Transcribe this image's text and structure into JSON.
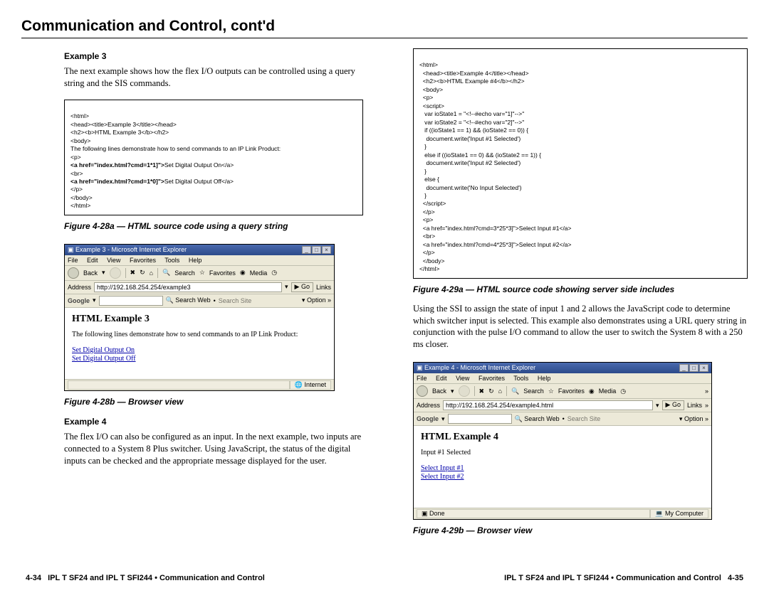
{
  "title": "Communication and Control, cont'd",
  "left": {
    "ex3_heading": "Example 3",
    "ex3_text": "The next example shows how the flex I/O outputs can be controlled using a query string and the SIS commands.",
    "code1": {
      "l1": "<html>",
      "l2": "<head><title>Example 3</title></head>",
      "l3": "<h2><b>HTML Example 3</b></h2>",
      "l4": "<body>",
      "l5": "The following lines demonstrate how to send commands to an IP Link Product:",
      "l6": "<p>",
      "l7a": "<a href=\"index.html?cmd=1*1]\">",
      "l7b": "Set Digital Output On</a>",
      "l8": "<br>",
      "l9a": "<a href=\"index.html?cmd=1*0]\">",
      "l9b": "Set Digital Output Off</a>",
      "l10": "</p>",
      "l11": "</body>",
      "l12": "</html>"
    },
    "caption_28a": "Figure 4-28a — HTML source code using a query string",
    "browser1": {
      "title": "Example 3 - Microsoft Internet Explorer",
      "menu": {
        "file": "File",
        "edit": "Edit",
        "view": "View",
        "fav": "Favorites",
        "tools": "Tools",
        "help": "Help"
      },
      "back": "Back",
      "search": "Search",
      "favorites": "Favorites",
      "media": "Media",
      "addr_label": "Address",
      "addr": "http://192.168.254.254/example3",
      "go": "Go",
      "links": "Links",
      "google": "Google",
      "sw": "Search Web",
      "ss": "Search Site",
      "opt": "Option",
      "heading": "HTML Example 3",
      "line": "The following lines demonstrate how to send commands to an IP Link Product:",
      "link1": "Set Digital Output On",
      "link2": "Set Digital Output Off",
      "status": "Internet"
    },
    "caption_28b": "Figure 4-28b — Browser view",
    "ex4_heading": "Example 4",
    "ex4_text": "The flex I/O can also be configured as an input.  In the next example, two inputs are connected to a System 8 Plus switcher.  Using JavaScript, the status of the digital inputs can be checked and the appropriate message displayed for the user."
  },
  "right": {
    "code2": {
      "l1": "<html>",
      "l2": "<head><title>Example 4</title></head>",
      "l3": "<h2><b>HTML Example #4</b></h2>",
      "l4": "<body>",
      "l5": "<p>",
      "l6": "<script>",
      "l7": " var ioState1 = \"<!--#echo var=\"1]\"-->\"",
      "l8": " var ioState2 = \"<!--#echo var=\"2]\"-->\"",
      "l9": " if ((ioState1 == 1) && (ioState2 == 0)) {",
      "l10": "  document.write('Input #1 Selected')",
      "l11": " }",
      "l12": " else if ((ioState1 == 0) && (ioState2 == 1)) {",
      "l13": "  document.write('Input #2 Selected')",
      "l14": " }",
      "l15": " else {",
      "l16": "  document.write('No Input Selected')",
      "l17": " }",
      "l18": "</script>",
      "l19": "</p>",
      "l20": "<p>",
      "l21": "<a href=\"index.html?cmd=3*25*3]\">Select Input #1</a>",
      "l22": "<br>",
      "l23": "<a href=\"index.html?cmd=4*25*3]\">Select Input #2</a>",
      "l24": "</p>",
      "l25": "</body>",
      "l26": "</html>"
    },
    "caption_29a": "Figure 4-29a — HTML source code showing server side includes",
    "para": "Using the SSI to assign the state of input 1 and 2 allows the JavaScript code to determine which switcher input is selected.  This example also demonstrates using a URL query string in conjunction with the pulse I/O command to allow the user to switch the System 8 with a 250 ms closer.",
    "browser2": {
      "title": "Example 4 - Microsoft Internet Explorer",
      "addr_label": "Address",
      "addr": "http://192.168.254.254/example4.html",
      "go": "Go",
      "heading": "HTML Example 4",
      "line": "Input #1 Selected",
      "link1": "Select Input #1",
      "link2": "Select Input #2",
      "status_l": "Done",
      "status_r": "My Computer"
    },
    "caption_29b": "Figure 4-29b — Browser view"
  },
  "footer": {
    "left_num": "4-34",
    "left_text": "IPL T SF24 and IPL T SFI244 • Communication and Control",
    "right_text": "IPL T SF24 and IPL T SFI244 • Communication and Control",
    "right_num": "4-35"
  }
}
